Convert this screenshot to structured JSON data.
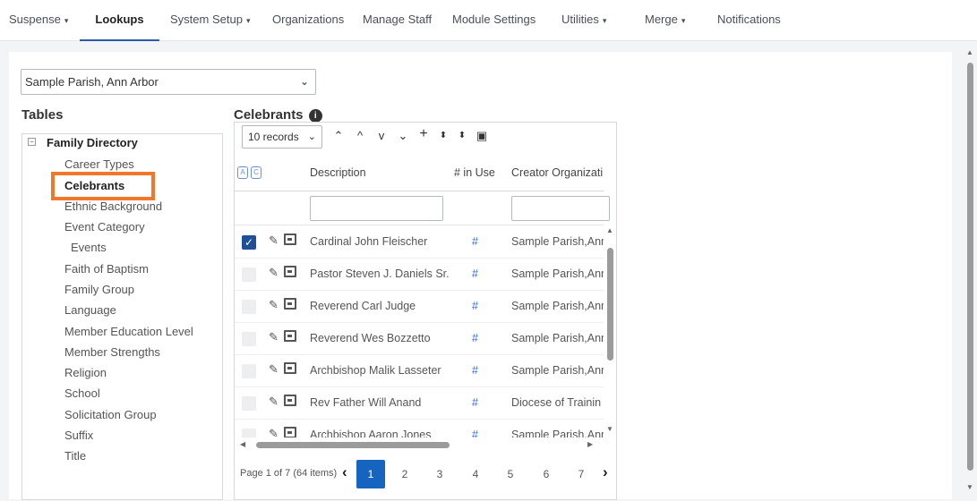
{
  "nav": {
    "items": [
      {
        "label": "Suspense",
        "caret": "▾"
      },
      {
        "label": "Lookups",
        "caret": ""
      },
      {
        "label": "System Setup",
        "caret": "▾"
      },
      {
        "label": "Organizations",
        "caret": ""
      },
      {
        "label": "Manage Staff",
        "caret": ""
      },
      {
        "label": "Module Settings",
        "caret": ""
      },
      {
        "label": "Utilities",
        "caret": "▾"
      },
      {
        "label": "Merge",
        "caret": "▾"
      },
      {
        "label": "Notifications",
        "caret": ""
      }
    ],
    "active": "Lookups"
  },
  "parish_select": {
    "value": "Sample Parish, Ann Arbor",
    "icon": "chevron-down-icon"
  },
  "tables_title": "Tables",
  "tree": {
    "root": "Family Directory",
    "expander": "⊟",
    "items": [
      "Career Types",
      "Celebrants",
      "Ethnic Background",
      "Event Category",
      "Events",
      "Faith of Baptism",
      "Family Group",
      "Language",
      "Member Education Level",
      "Member Strengths",
      "Religion",
      "School",
      "Solicitation Group",
      "Suffix",
      "Title"
    ],
    "selected": "Celebrants"
  },
  "grid_title": "Celebrants",
  "toolbar": {
    "records": "10 records",
    "icons": [
      "double-chevron-up-icon",
      "chevron-up-icon",
      "chevron-down-icon",
      "double-chevron-down-icon",
      "plus-icon",
      "sort-icon",
      "sort-icon",
      "save-icon"
    ]
  },
  "columns": {
    "description": "Description",
    "in_use": "# in Use",
    "creator": "Creator Organizati"
  },
  "column_toggles": [
    "A",
    "C"
  ],
  "rows": [
    {
      "checked": true,
      "description": "Cardinal John Fleischer",
      "in_use": "#",
      "creator": "Sample Parish,Ann"
    },
    {
      "checked": false,
      "description": "Pastor Steven J. Daniels Sr.",
      "in_use": "#",
      "creator": "Sample Parish,Ann"
    },
    {
      "checked": false,
      "description": "Reverend Carl Judge",
      "in_use": "#",
      "creator": "Sample Parish,Ann"
    },
    {
      "checked": false,
      "description": "Reverend Wes Bozzetto",
      "in_use": "#",
      "creator": "Sample Parish,Ann"
    },
    {
      "checked": false,
      "description": "Archbishop Malik Lasseter",
      "in_use": "#",
      "creator": "Sample Parish,Ann"
    },
    {
      "checked": false,
      "description": "Rev Father Will Anand",
      "in_use": "#",
      "creator": "Diocese of Trainin"
    },
    {
      "checked": false,
      "description": "Archbishop Aaron Jones",
      "in_use": "#",
      "creator": "Sample Parish,Ann"
    }
  ],
  "pager": {
    "info": "Page 1 of 7 (64 items)",
    "pages": [
      "1",
      "2",
      "3",
      "4",
      "5",
      "6",
      "7"
    ],
    "current": "1",
    "prev": "‹",
    "next": "›"
  },
  "colors": {
    "accent": "#1565c0",
    "highlight": "#f0782a",
    "link": "#2f6fd6",
    "checkbox": "#1f4f97"
  }
}
